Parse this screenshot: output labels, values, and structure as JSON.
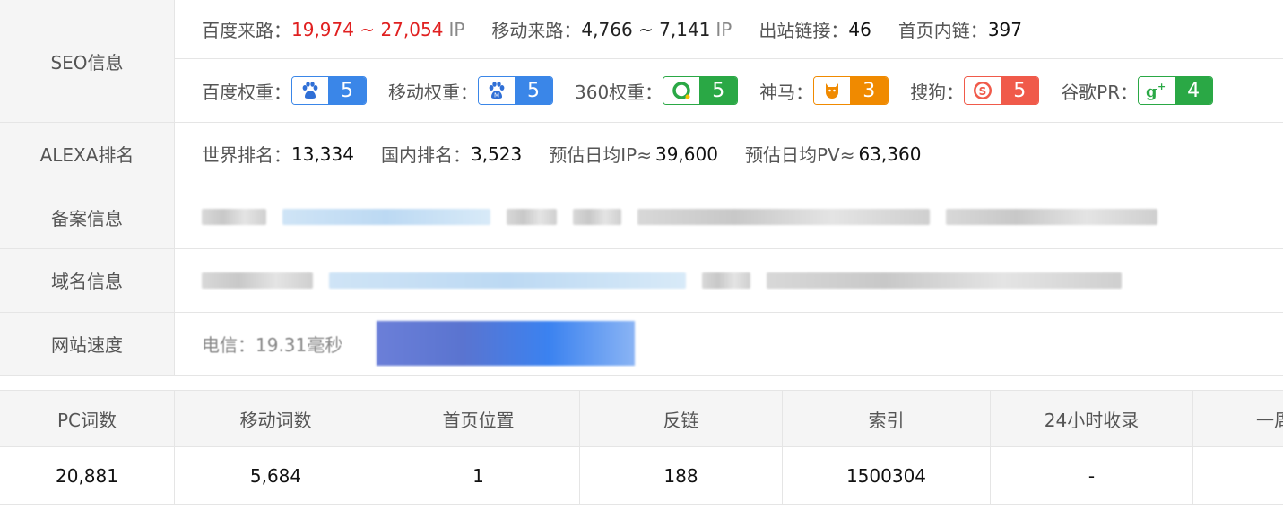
{
  "seo": {
    "label": "SEO信息",
    "baidu_traffic_label": "百度来路：",
    "baidu_traffic_value": "19,974 ~ 27,054",
    "baidu_traffic_unit": "IP",
    "mobile_traffic_label": "移动来路：",
    "mobile_traffic_value": "4,766 ~ 7,141",
    "mobile_traffic_unit": "IP",
    "outbound_label": "出站链接：",
    "outbound_value": "46",
    "internal_label": "首页内链：",
    "internal_value": "397",
    "weights": [
      {
        "label": "百度权重：",
        "value": "5",
        "icon": "baidu-paw-icon",
        "color": "#3a86e8"
      },
      {
        "label": "移动权重：",
        "value": "5",
        "icon": "baidu-mobile-paw-icon",
        "color": "#3a86e8"
      },
      {
        "label": "360权重：",
        "value": "5",
        "icon": "so360-icon",
        "color": "#2aa845"
      },
      {
        "label": "神马：",
        "value": "3",
        "icon": "shenma-icon",
        "color": "#f08a00"
      },
      {
        "label": "搜狗：",
        "value": "5",
        "icon": "sogou-icon",
        "color": "#f05a4a"
      },
      {
        "label": "谷歌PR：",
        "value": "4",
        "icon": "google-plus-icon",
        "color": "#2aa845"
      }
    ]
  },
  "alexa": {
    "label": "ALEXA排名",
    "world_label": "世界排名：",
    "world_value": "13,334",
    "domestic_label": "国内排名：",
    "domestic_value": "3,523",
    "ip_label": "预估日均IP≈",
    "ip_value": "39,600",
    "pv_label": "预估日均PV≈",
    "pv_value": "63,360"
  },
  "icp": {
    "label": "备案信息"
  },
  "domain": {
    "label": "域名信息"
  },
  "speed": {
    "label": "网站速度",
    "telecom_text": "电信：19.31毫秒"
  },
  "stats": {
    "headers": [
      "PC词数",
      "移动词数",
      "首页位置",
      "反链",
      "索引",
      "24小时收录",
      "一周"
    ],
    "values": [
      "20,881",
      "5,684",
      "1",
      "188",
      "1500304",
      "-",
      ""
    ]
  }
}
